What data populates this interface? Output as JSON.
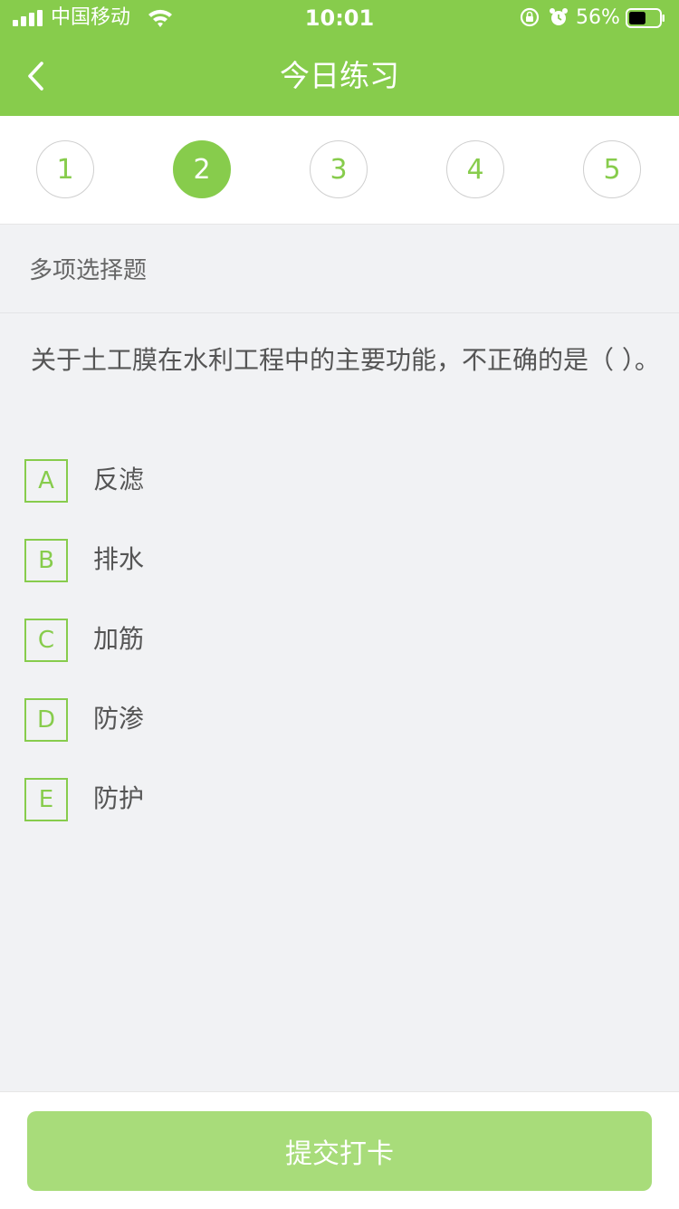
{
  "status_bar": {
    "carrier": "中国移动",
    "time": "10:01",
    "battery_percent": "56%",
    "battery_level": 0.56
  },
  "header": {
    "title": "今日练习",
    "back_icon": "chevron-left-icon"
  },
  "question_nav": {
    "numbers": [
      "1",
      "2",
      "3",
      "4",
      "5"
    ],
    "active": "2"
  },
  "question": {
    "type": "多项选择题",
    "text": "关于土工膜在水利工程中的主要功能，不正确的是（ ）。",
    "options": [
      {
        "letter": "A",
        "text": "反滤"
      },
      {
        "letter": "B",
        "text": "排水"
      },
      {
        "letter": "C",
        "text": "加筋"
      },
      {
        "letter": "D",
        "text": "防渗"
      },
      {
        "letter": "E",
        "text": "防护"
      }
    ]
  },
  "footer": {
    "submit_label": "提交打卡"
  },
  "colors": {
    "accent": "#87cc4c",
    "submit_disabled": "#a8dc7a",
    "background": "#f1f2f4"
  }
}
